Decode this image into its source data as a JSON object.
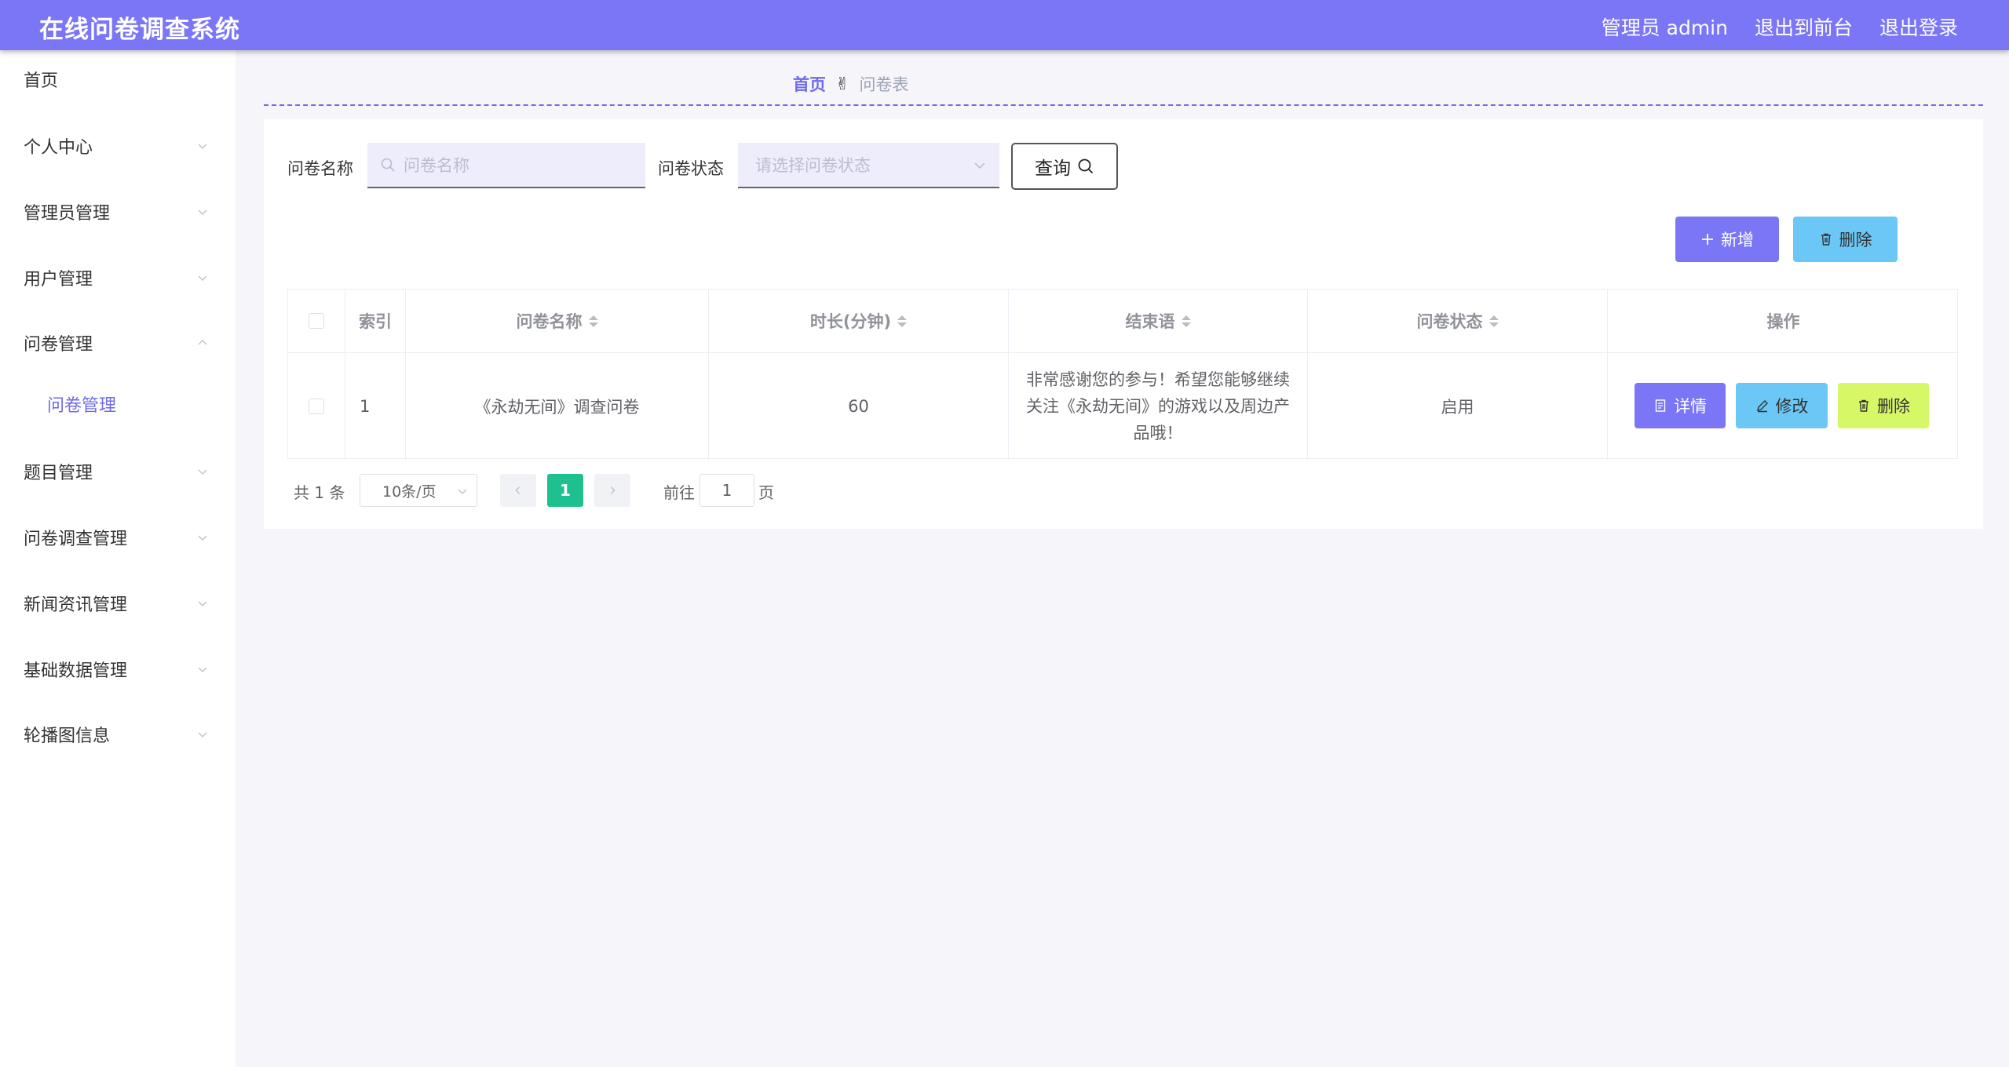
{
  "header": {
    "title": "在线问卷调查系统",
    "user_label": "管理员 admin",
    "to_frontend": "退出到前台",
    "logout": "退出登录"
  },
  "sidebar": {
    "items": [
      {
        "label": "首页"
      },
      {
        "label": "个人中心"
      },
      {
        "label": "管理员管理"
      },
      {
        "label": "用户管理"
      },
      {
        "label": "问卷管理"
      },
      {
        "label": "问卷管理"
      },
      {
        "label": "题目管理"
      },
      {
        "label": "问卷调查管理"
      },
      {
        "label": "新闻资讯管理"
      },
      {
        "label": "基础数据管理"
      },
      {
        "label": "轮播图信息"
      }
    ]
  },
  "breadcrumb": {
    "home": "首页",
    "hand": "✌",
    "current": "问卷表"
  },
  "search": {
    "name_label": "问卷名称",
    "name_placeholder": "问卷名称",
    "status_label": "问卷状态",
    "status_placeholder": "请选择问卷状态",
    "query_label": "查询"
  },
  "actions": {
    "add_label": "新增",
    "delete_label": "删除"
  },
  "table": {
    "headers": {
      "index": "索引",
      "name": "问卷名称",
      "duration": "时长(分钟)",
      "closing": "结束语",
      "status": "问卷状态",
      "operations": "操作"
    },
    "rows": [
      {
        "index": "1",
        "name": "《永劫无间》调查问卷",
        "duration": "60",
        "closing": "非常感谢您的参与！希望您能够继续关注《永劫无间》的游戏以及周边产品哦！",
        "status": "启用",
        "detail_label": "详情",
        "edit_label": "修改",
        "delete_label": "删除"
      }
    ]
  },
  "pagination": {
    "total": "共 1 条",
    "page_size": "10条/页",
    "current_page": "1",
    "goto_label": "前往",
    "goto_value": "1",
    "page_suffix": "页"
  },
  "colors": {
    "primary": "#7a76f6",
    "info": "#6ac7f6",
    "warning": "#d6f766",
    "pager_active": "#1ec08f"
  }
}
